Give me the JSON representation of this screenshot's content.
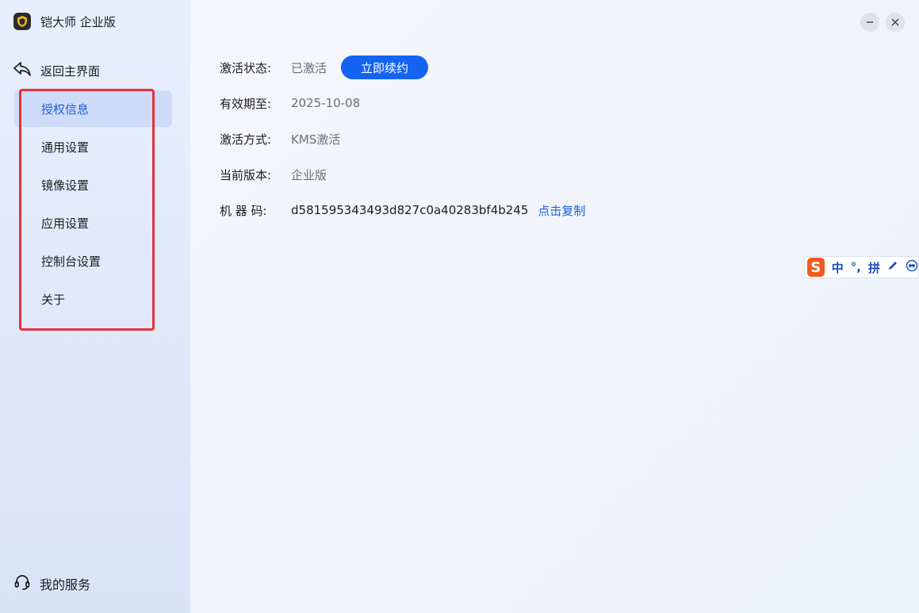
{
  "app": {
    "title": "铠大师 企业版",
    "logo_icon": "shield-logo-icon"
  },
  "sidebar": {
    "back_label": "返回主界面",
    "items": [
      {
        "label": "授权信息",
        "active": true
      },
      {
        "label": "通用设置",
        "active": false
      },
      {
        "label": "镜像设置",
        "active": false
      },
      {
        "label": "应用设置",
        "active": false
      },
      {
        "label": "控制台设置",
        "active": false
      },
      {
        "label": "关于",
        "active": false
      }
    ],
    "service_label": "我的服务"
  },
  "license": {
    "status_label": "激活状态:",
    "status_value": "已激活",
    "renew_button": "立即续约",
    "expiry_label": "有效期至:",
    "expiry_value": "2025-10-08",
    "method_label": "激活方式:",
    "method_value": "KMS激活",
    "version_label": "当前版本:",
    "version_value": "企业版",
    "machine_label": "机 器 码:",
    "machine_value": "d581595343493d827c0a40283bf4b245",
    "copy_link": "点击复制"
  },
  "ime": {
    "logo": "S",
    "mode": "中",
    "punct": "°,",
    "pinyin": "拼"
  },
  "colors": {
    "accent": "#1463f3",
    "active_bg": "#cfdcf9",
    "highlight": "#e8303b"
  }
}
